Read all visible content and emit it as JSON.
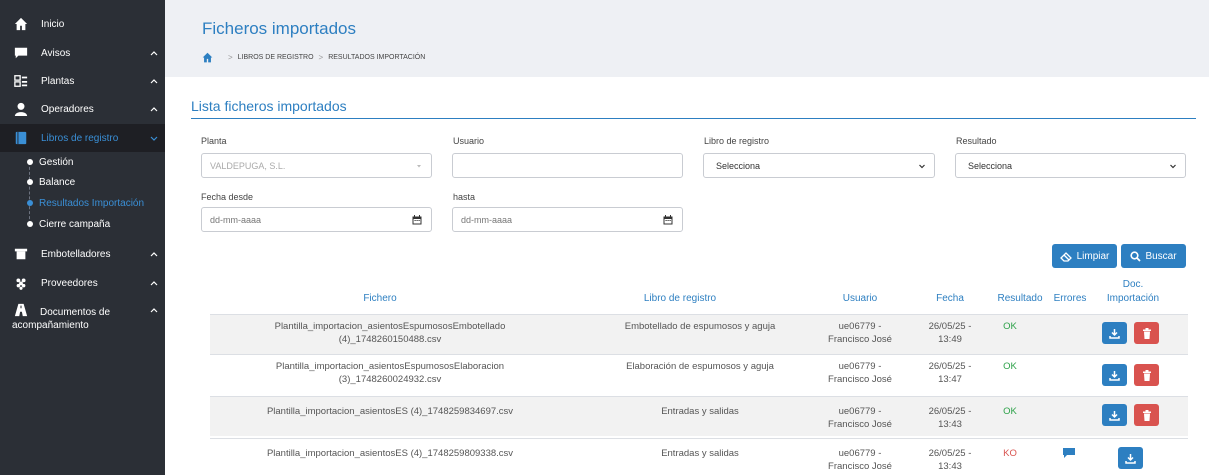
{
  "sidebar": {
    "items": [
      {
        "label": "Inicio",
        "icon": "home-icon"
      },
      {
        "label": "Avisos",
        "icon": "message-icon"
      },
      {
        "label": "Plantas",
        "icon": "plant-icon"
      },
      {
        "label": "Operadores",
        "icon": "user-icon"
      },
      {
        "label": "Libros de registro",
        "icon": "book-icon"
      },
      {
        "label": "Embotelladores",
        "icon": "bottler-icon"
      },
      {
        "label": "Proveedores",
        "icon": "grapes-icon"
      },
      {
        "label": "Documentos de acompañamiento",
        "icon": "road-icon"
      }
    ],
    "subitems": [
      {
        "label": "Gestión"
      },
      {
        "label": "Balance"
      },
      {
        "label": "Resultados Importación"
      },
      {
        "label": "Cierre campaña"
      }
    ]
  },
  "header": {
    "title": "Ficheros importados",
    "breadcrumb": [
      "LIBROS DE REGISTRO",
      "RESULTADOS IMPORTACIÓN"
    ]
  },
  "section": {
    "title": "Lista ficheros importados"
  },
  "filters": {
    "planta_label": "Planta",
    "planta_value": "VALDEPUGA, S.L.",
    "usuario_label": "Usuario",
    "usuario_value": "",
    "libro_label": "Libro de registro",
    "libro_value": "Selecciona",
    "resultado_label": "Resultado",
    "resultado_value": "Selecciona",
    "fecha_desde_label": "Fecha desde",
    "fecha_desde_placeholder": "dd-mm-aaaa",
    "hasta_label": "hasta",
    "hasta_placeholder": "dd-mm-aaaa"
  },
  "buttons": {
    "limpiar": "Limpiar",
    "buscar": "Buscar"
  },
  "table": {
    "headers": {
      "fichero": "Fichero",
      "libro": "Libro de registro",
      "usuario": "Usuario",
      "fecha": "Fecha",
      "resultado": "Resultado",
      "errores": "Errores",
      "doc_line1": "Doc.",
      "doc_line2": "Importación"
    },
    "rows": [
      {
        "fichero_1": "Plantilla_importacion_asientosEspumososEmbotellado",
        "fichero_2": "(4)_1748260150488.csv",
        "libro": "Embotellado de espumosos y aguja",
        "usuario_1": "ue06779 -",
        "usuario_2": "Francisco José",
        "fecha_1": "26/05/25 -",
        "fecha_2": "13:49",
        "resultado": "OK"
      },
      {
        "fichero_1": "Plantilla_importacion_asientosEspumososElaboracion",
        "fichero_2": "(3)_1748260024932.csv",
        "libro": "Elaboración de espumosos y aguja",
        "usuario_1": "ue06779 -",
        "usuario_2": "Francisco José",
        "fecha_1": "26/05/25 -",
        "fecha_2": "13:47",
        "resultado": "OK"
      },
      {
        "fichero_1": "Plantilla_importacion_asientosES (4)_1748259834697.csv",
        "fichero_2": "",
        "libro": "Entradas y salidas",
        "usuario_1": "ue06779 -",
        "usuario_2": "Francisco José",
        "fecha_1": "26/05/25 -",
        "fecha_2": "13:43",
        "resultado": "OK"
      },
      {
        "fichero_1": "Plantilla_importacion_asientosES (4)_1748259809338.csv",
        "fichero_2": "",
        "libro": "Entradas y salidas",
        "usuario_1": "ue06779 -",
        "usuario_2": "Francisco José",
        "fecha_1": "26/05/25 -",
        "fecha_2": "13:43",
        "resultado": "KO"
      }
    ]
  },
  "colors": {
    "sidebar_bg": "#2b2f36",
    "accent": "#2d7fc1",
    "ok": "#2ea24a",
    "ko": "#d9534f"
  }
}
